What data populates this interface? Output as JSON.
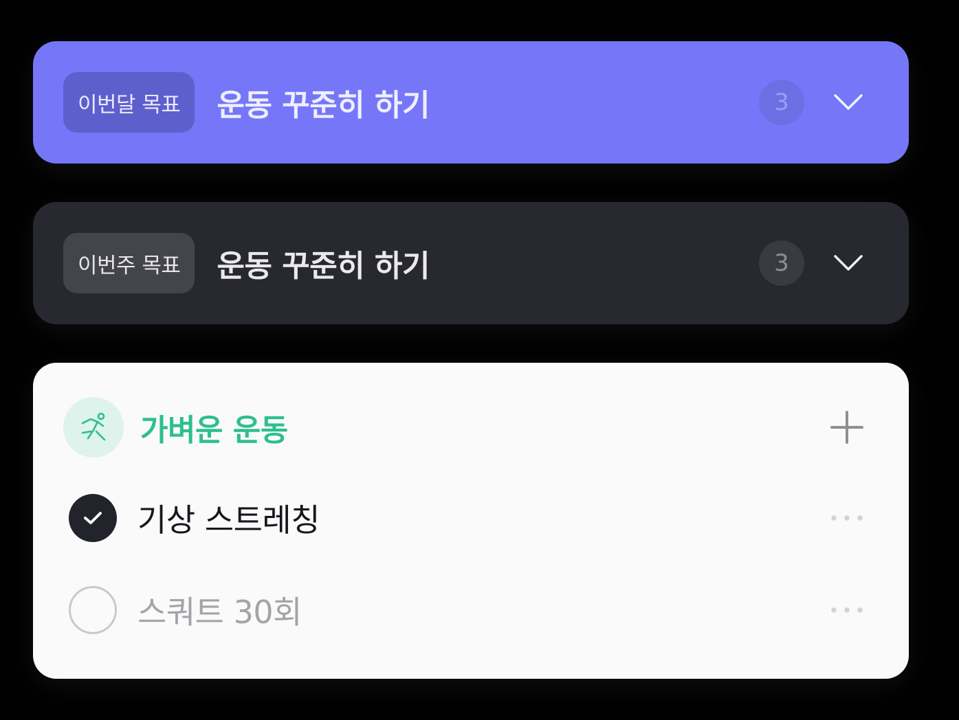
{
  "monthly_goal": {
    "tag": "이번달 목표",
    "title": "운동 꾸준히 하기",
    "count": "3",
    "accent_color": "#7577F8",
    "expand_icon": "chevron-down-icon"
  },
  "weekly_goal": {
    "tag": "이번주 목표",
    "title": "운동 꾸준히 하기",
    "count": "3",
    "accent_color": "#272830",
    "expand_icon": "chevron-down-icon"
  },
  "category": {
    "title": "가벼운 운동",
    "icon": "running-icon",
    "color": "#2DBF8C",
    "add_icon": "plus-icon",
    "todos": [
      {
        "label": "기상 스트레칭",
        "done": true
      },
      {
        "label": "스쿼트 30회",
        "done": false
      }
    ]
  }
}
